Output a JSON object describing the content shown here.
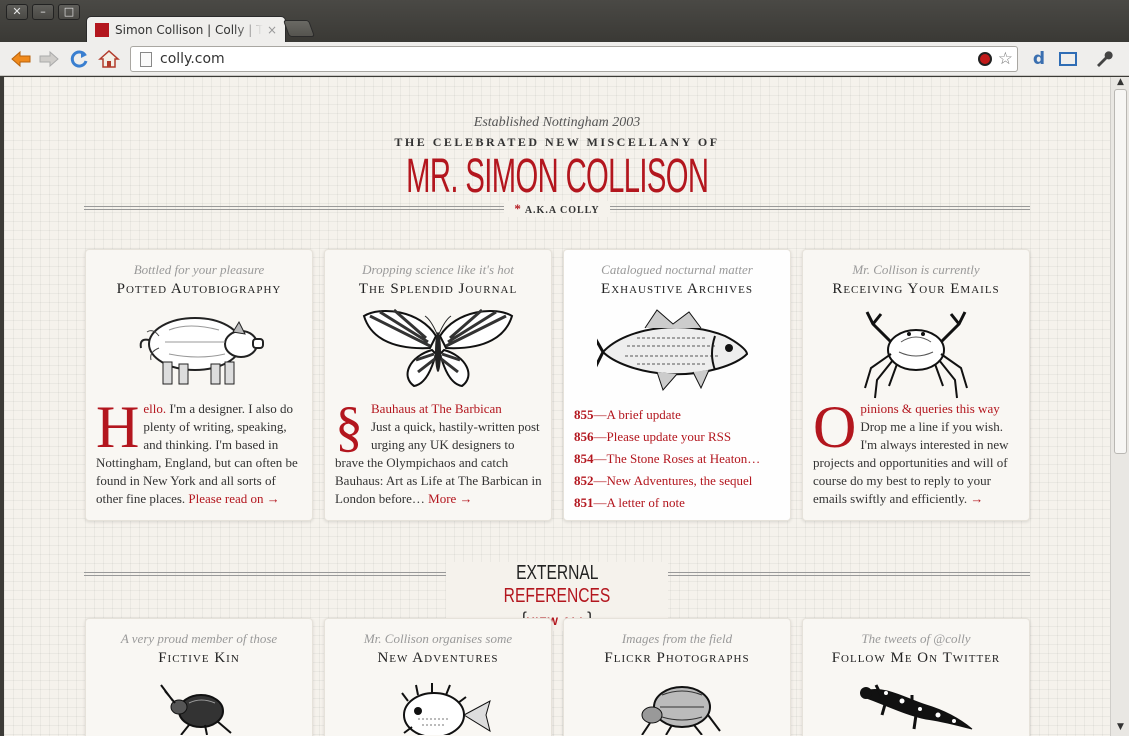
{
  "browser": {
    "window_buttons": [
      "✕",
      "–",
      "□"
    ],
    "tab": {
      "title": "Simon Collison | Colly | The",
      "close": "×"
    },
    "url": "colly.com"
  },
  "masthead": {
    "established": "Established Nottingham 2003",
    "celebrated": "THE CELEBRATED NEW MISCELLANY OF",
    "title": "MR. SIMON COLLISON",
    "aka_star": "*",
    "aka": "A.K.A COLLY"
  },
  "cards": [
    {
      "kicker": "Bottled for your pleasure",
      "title": "Potted Autobiography",
      "art": "pig-illustration",
      "dropcap": "H",
      "link": "ello.",
      "text": " I'm a designer. I also do plenty of writing, speaking, and thinking. I'm based in Nottingham, England, but can often be found in New York and all sorts of other fine places. ",
      "more": "Please read on →"
    },
    {
      "kicker": "Dropping science like it's hot",
      "title": "The Splendid Journal",
      "art": "butterfly-illustration",
      "dropcap": "§",
      "link": "Bauhaus at The Barbican",
      "text": "Just a quick, hastily-written post urging any UK designers to brave the Olympichaos and catch Bauhaus: Art as Life at The Barbican in London before…",
      "more": "More →"
    },
    {
      "kicker": "Catalogued nocturnal matter",
      "title": "Exhaustive Archives",
      "art": "fish-illustration",
      "entries": [
        {
          "num": "855",
          "title": "—A brief update"
        },
        {
          "num": "856",
          "title": "—Please update your RSS"
        },
        {
          "num": "854",
          "title": "—The Stone Roses at Heaton…"
        },
        {
          "num": "852",
          "title": "—New Adventures, the sequel"
        },
        {
          "num": "851",
          "title": "—A letter of note"
        }
      ]
    },
    {
      "kicker": "Mr. Collison is currently",
      "title": "Receiving Your Emails",
      "art": "crab-illustration",
      "dropcap": "O",
      "link": "pinions & queries this way",
      "text": " Drop me a line if you wish. I'm always interested in new projects and opportunities and will of course do my best to reply to your emails swiftly and efficiently. ",
      "more": "→"
    }
  ],
  "external": {
    "word1": "EXTERNAL",
    "word2": "REFERENCES",
    "open_brace": "{",
    "view_all": "VIEW ALL",
    "close_brace": "}"
  },
  "ext_cards": [
    {
      "kicker": "A very proud member of those",
      "title": "Fictive Kin",
      "art": "beetle-illustration"
    },
    {
      "kicker": "Mr. Collison organises some",
      "title": "New Adventures",
      "art": "pufferfish-illustration"
    },
    {
      "kicker": "Images from the field",
      "title": "Flickr Photographs",
      "art": "flea-illustration"
    },
    {
      "kicker": "The tweets of @colly",
      "title": "Follow Me On Twitter",
      "art": "salamander-illustration"
    }
  ],
  "colors": {
    "accent": "#b3161e",
    "paper": "#f5f2ec"
  }
}
